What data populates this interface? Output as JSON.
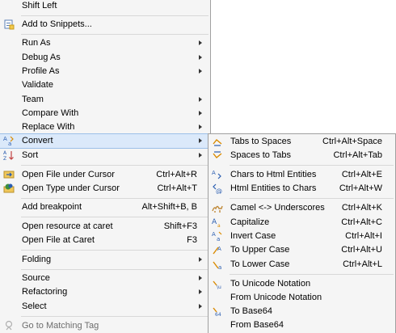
{
  "main_menu": {
    "shift_left": "Shift Left",
    "add_to_snippets": "Add to Snippets...",
    "run_as": "Run As",
    "debug_as": "Debug As",
    "profile_as": "Profile As",
    "validate": "Validate",
    "team": "Team",
    "compare_with": "Compare With",
    "replace_with": "Replace With",
    "convert": "Convert",
    "sort": "Sort",
    "open_file_under_cursor": "Open File under Cursor",
    "open_file_under_cursor_accel": "Ctrl+Alt+R",
    "open_type_under_cursor": "Open Type under Cursor",
    "open_type_under_cursor_accel": "Ctrl+Alt+T",
    "add_breakpoint": "Add breakpoint",
    "add_breakpoint_accel": "Alt+Shift+B, B",
    "open_resource_at_caret": "Open resource at caret",
    "open_resource_at_caret_accel": "Shift+F3",
    "open_file_at_caret": "Open File at Caret",
    "open_file_at_caret_accel": "F3",
    "folding": "Folding",
    "source": "Source",
    "refactoring": "Refactoring",
    "select": "Select",
    "go_to_matching_tag": "Go to Matching Tag"
  },
  "convert_menu": {
    "tabs_to_spaces": "Tabs to Spaces",
    "tabs_to_spaces_accel": "Ctrl+Alt+Space",
    "spaces_to_tabs": "Spaces to Tabs",
    "spaces_to_tabs_accel": "Ctrl+Alt+Tab",
    "chars_to_html": "Chars to Html Entities",
    "chars_to_html_accel": "Ctrl+Alt+E",
    "html_to_chars": "Html Entities to Chars",
    "html_to_chars_accel": "Ctrl+Alt+W",
    "camel_underscores": "Camel <-> Underscores",
    "camel_underscores_accel": "Ctrl+Alt+K",
    "capitalize": "Capitalize",
    "capitalize_accel": "Ctrl+Alt+C",
    "invert_case": "Invert Case",
    "invert_case_accel": "Ctrl+Alt+I",
    "to_upper_case": "To Upper Case",
    "to_upper_case_accel": "Ctrl+Alt+U",
    "to_lower_case": "To Lower Case",
    "to_lower_case_accel": "Ctrl+Alt+L",
    "to_unicode": "To Unicode Notation",
    "from_unicode": "From Unicode Notation",
    "to_base64": "To Base64",
    "from_base64": "From Base64"
  },
  "colors": {
    "highlight": "#dbe9fa",
    "highlight_border": "#9cc0e8",
    "menu_bg": "#f5f5f5"
  }
}
